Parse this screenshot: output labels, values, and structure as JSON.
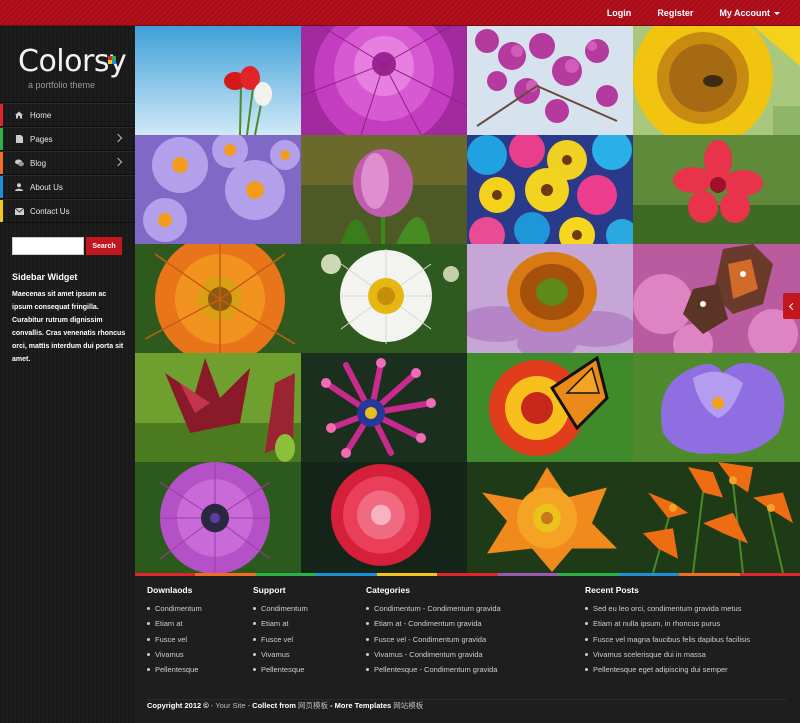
{
  "topnav": {
    "login": "Login",
    "register": "Register",
    "account": "My Account"
  },
  "logo": {
    "title": "Colorsy",
    "subtitle": "a portfolio theme"
  },
  "sidebar": {
    "items": [
      {
        "label": "Home",
        "icon": "home-icon",
        "color": "#e0262d"
      },
      {
        "label": "Pages",
        "icon": "file-icon",
        "color": "#2bb34a"
      },
      {
        "label": "Blog",
        "icon": "comments-icon",
        "color": "#f26d21"
      },
      {
        "label": "About Us",
        "icon": "user-icon",
        "color": "#1e8fd6"
      },
      {
        "label": "Contact Us",
        "icon": "envelope-icon",
        "color": "#f4c51c"
      }
    ],
    "search_button": "Search",
    "widget_title": "Sidebar Widget",
    "widget_text": "Maecenas sit amet ipsum ac ipsum consequat fringilla. Curabitur rutrum dignissim convallis. Cras venenatis rhoncus orci, mattis interdum dui porta sit amet."
  },
  "gallery": {
    "images": [
      "red-tulips-sky",
      "pink-dahlia",
      "purple-bougainvillea",
      "sunflower-bee",
      "purple-asters",
      "pink-tulip",
      "colorful-gerberas",
      "red-flower",
      "orange-gerbera",
      "white-daisy",
      "echinacea",
      "butterfly-on-pink",
      "red-lily",
      "purple-spider-daisy",
      "monarch-on-zinnia",
      "purple-crocus",
      "purple-osteospermum",
      "red-pompom-daisy",
      "orange-dahlia",
      "orange-lilies"
    ]
  },
  "footer": {
    "columns": [
      {
        "title": "Downlaods",
        "items": [
          "Condimentum",
          "Etiam at",
          "Fusce vel",
          "Vivamus",
          "Pellentesque"
        ]
      },
      {
        "title": "Support",
        "items": [
          "Condimentum",
          "Etiam at",
          "Fusce vel",
          "Vivamus",
          "Pellentesque"
        ]
      },
      {
        "title": "Categories",
        "items": [
          "Condimentum - Condimentum gravida",
          "Etiam at - Condimentum gravida",
          "Fusce vel - Condimentum gravida",
          "Vivamus - Condimentum gravida",
          "Pellentesque - Condimentum gravida"
        ]
      },
      {
        "title": "Recent Posts",
        "items": [
          "Sed eu leo orci, condimentum gravida metus",
          "Etiam at nulla ipsum, in rhoncus purus",
          "Fusce vel magna faucibus felis dapibus facilisis",
          "Vivamus scelerisque dui in massa",
          "Pellentesque eget adipiscing dui semper"
        ]
      }
    ],
    "copyright": "Copyright 2012 ©",
    "site": " - Your Site - ",
    "collect": "Collect from ",
    "collect_link": "网页模板",
    "more": " - More Templates ",
    "more_link": "网站模板"
  }
}
